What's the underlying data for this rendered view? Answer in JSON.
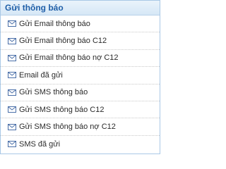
{
  "header": {
    "title": "Gửi thông báo"
  },
  "colors": {
    "accent": "#1f5fa8",
    "envelope": "#4a6fa8"
  },
  "items": [
    {
      "label": "Gửi Email thông báo",
      "icon": "envelope-icon"
    },
    {
      "label": "Gửi Email thông báo C12",
      "icon": "envelope-icon"
    },
    {
      "label": "Gửi Email thông báo nợ C12",
      "icon": "envelope-icon"
    },
    {
      "label": "Email đã gửi",
      "icon": "envelope-icon"
    },
    {
      "label": "Gửi SMS thông báo",
      "icon": "envelope-icon"
    },
    {
      "label": "Gửi SMS thông báo C12",
      "icon": "envelope-icon"
    },
    {
      "label": "Gửi SMS thông báo nợ C12",
      "icon": "envelope-icon"
    },
    {
      "label": "SMS đã gửi",
      "icon": "envelope-icon"
    }
  ]
}
